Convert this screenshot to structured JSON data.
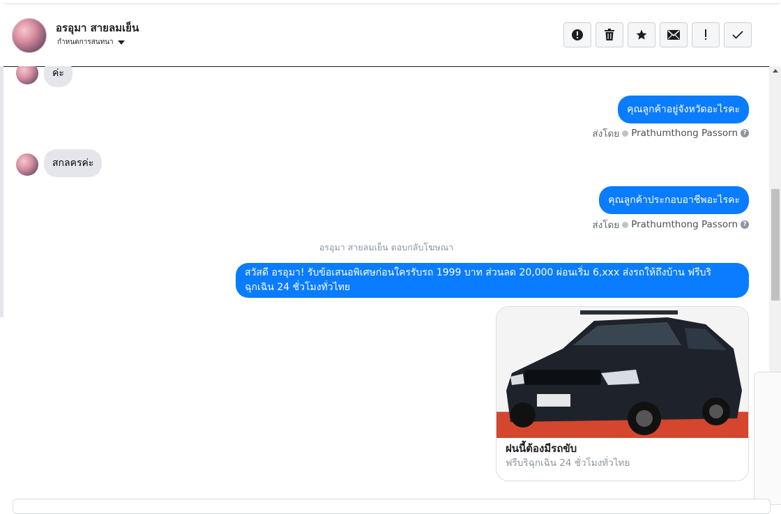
{
  "header": {
    "contact_name": "อรอุมา สายลมเย็น",
    "conversation_settings": "กำหนดการสนทนา",
    "toolbar": [
      {
        "icon": "exclamation-circle-icon",
        "glyph": "!"
      },
      {
        "icon": "trash-icon",
        "glyph": "🗑"
      },
      {
        "icon": "star-icon",
        "glyph": "★"
      },
      {
        "icon": "envelope-icon",
        "glyph": "✉"
      },
      {
        "icon": "exclamation-icon",
        "glyph": "!"
      },
      {
        "icon": "checkmark-icon",
        "glyph": "✓"
      }
    ]
  },
  "messages": {
    "m1_in": "ค่ะ",
    "m2_out": "คุณลูกค้าอยู่จังหวัดอะไรคะ",
    "m2_sent_by_prefix": "ส่งโดย",
    "m2_sent_by_name": "Prathumthong Passorn",
    "m3_in": "สกลครค่ะ",
    "m4_out": "คุณลูกค้าประกอบอาชีพอะไรคะ",
    "m4_sent_by_prefix": "ส่งโดย",
    "m4_sent_by_name": "Prathumthong Passorn",
    "ad_reply_notice": "อรอุมา สายลมเย็น ตอบกลับโฆษณา",
    "m5_out": "สวัสดี อรอุมา! รับข้อเสนอพิเศษก่อนใครรับรถ 1999 บาท ส่วนลด 20,000  ผ่อนเริ่ม 6,xxx ส่งรถให้ถึงบ้าน ฟรีบริ ฉุกเฉิน 24 ชั่วโมงทั่วไทย"
  },
  "ad_card": {
    "title": "ฝนนี้ต้องมีรถขับ",
    "subtitle": "ฟรีบริฉุกเฉิน 24 ชั่วโมงทั่วไทย",
    "image": "black-pickup-truck-photo"
  },
  "colors": {
    "outgoing_bubble": "#0a7cff",
    "incoming_bubble": "#e4e6eb"
  }
}
